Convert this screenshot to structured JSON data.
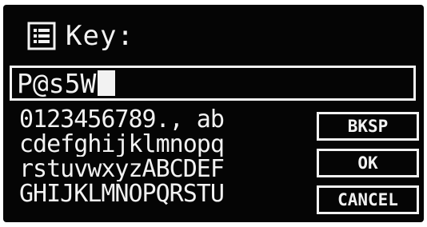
{
  "screen": {
    "title": "Key:",
    "header_icon": "menu-list-icon",
    "input_value": "P@s5W",
    "char_rows": [
      "0123456789., ab",
      "cdefghijklmnopq",
      "rstuvwxyzABCDEF",
      "GHIJKLMNOPQRSTU"
    ],
    "buttons": {
      "backspace": "BKSP",
      "ok": "OK",
      "cancel": "CANCEL"
    }
  },
  "colors": {
    "background": "#050505",
    "foreground": "#f2f2f2"
  }
}
